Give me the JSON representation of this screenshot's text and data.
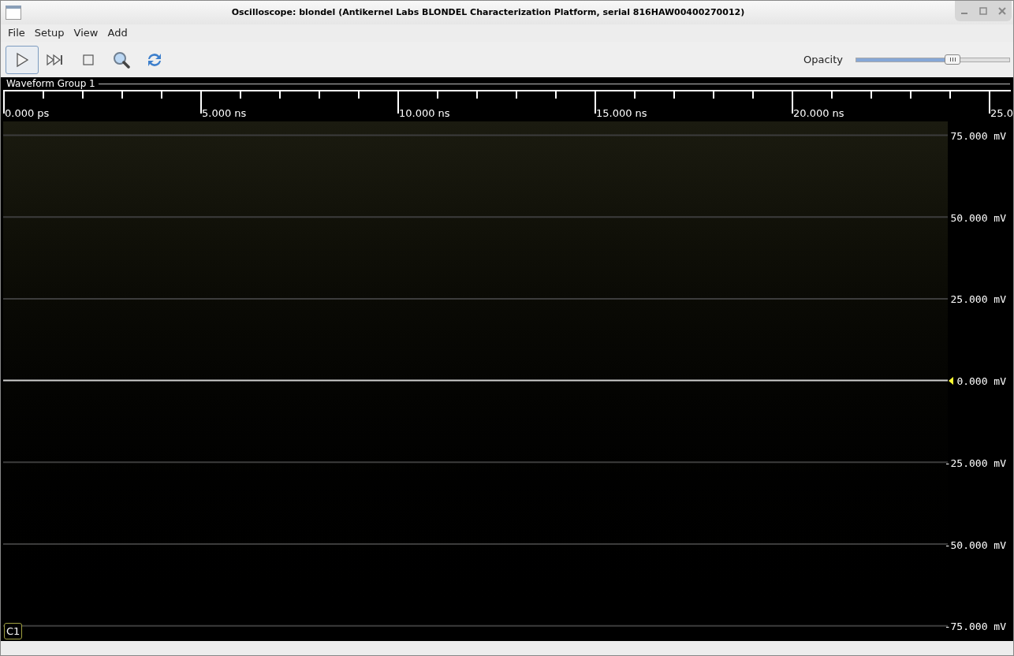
{
  "window": {
    "title": "Oscilloscope: blondel (Antikernel Labs BLONDEL Characterization Platform, serial  816HAW00400270012)"
  },
  "menu": [
    "File",
    "Setup",
    "View",
    "Add"
  ],
  "toolbar": [
    {
      "kind": "play",
      "selected": true
    },
    {
      "kind": "single",
      "selected": false
    },
    {
      "kind": "stop",
      "selected": false
    },
    {
      "kind": "zoom",
      "selected": false
    },
    {
      "kind": "refresh",
      "selected": false
    }
  ],
  "opacity": {
    "label": "Opacity",
    "level": 0.63
  },
  "group": {
    "title": "Waveform Group 1",
    "time_labels": [
      "0.000 ps",
      "5.000 ns",
      "10.000 ns",
      "15.000 ns",
      "20.000 ns",
      "25.0"
    ],
    "volt_labels": [
      "75.000 mV",
      "50.000 mV",
      "25.000 mV",
      "0.000 mV",
      "-25.000 mV",
      "-50.000 mV",
      "-75.000 mV"
    ],
    "channel": {
      "label": "C1",
      "color": "#a0a040"
    }
  }
}
